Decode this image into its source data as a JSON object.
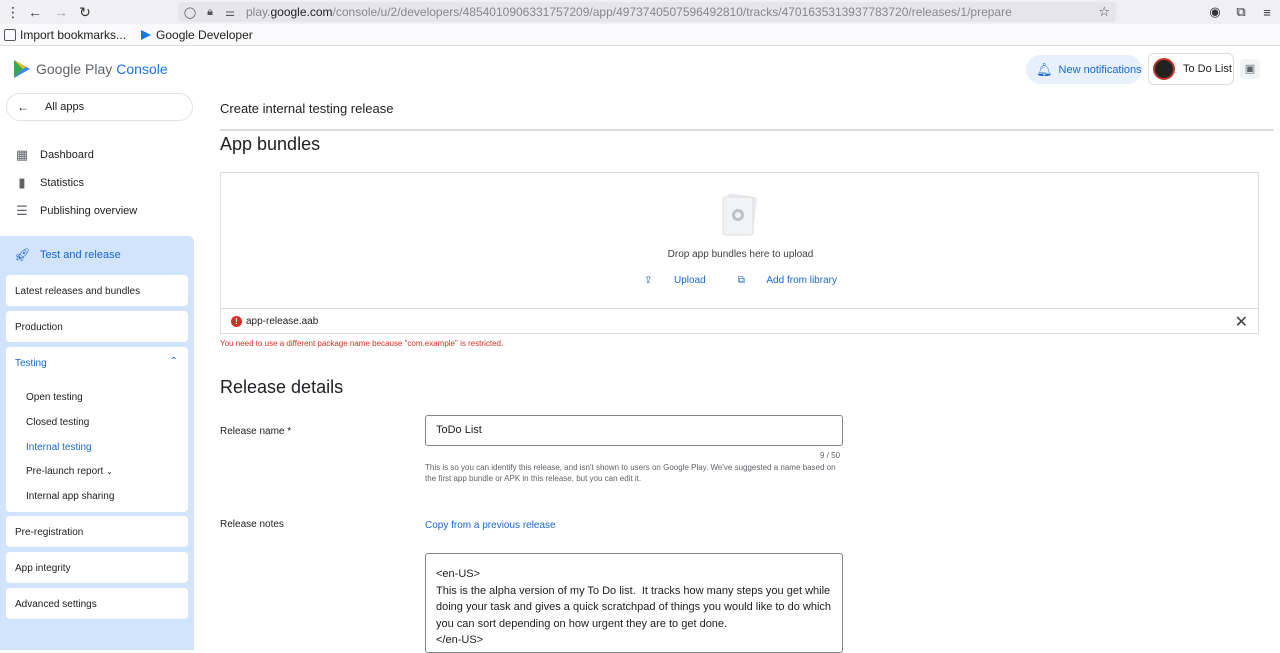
{
  "browser": {
    "url_prefix": "play.",
    "url_domain": "google.com",
    "url_path": "/console/u/2/developers/4854010906331757209/app/4973740507596492810/tracks/4701635313937783720/releases/1/prepare",
    "bookmarks": [
      {
        "label": "Import bookmarks..."
      },
      {
        "label": "Google Developer"
      }
    ]
  },
  "header": {
    "brand": "Google Play",
    "brand_suffix": "Console",
    "notifications_label": "New notifications",
    "account_label": "To Do List"
  },
  "sidebar": {
    "all_apps": "All apps",
    "items": [
      {
        "label": "Dashboard",
        "icon": "dashboard-icon"
      },
      {
        "label": "Statistics",
        "icon": "bar-chart-icon"
      },
      {
        "label": "Publishing overview",
        "icon": "publish-icon"
      }
    ],
    "section": {
      "label": "Test and release",
      "icon": "rocket-icon",
      "cards": [
        {
          "label": "Latest releases and bundles"
        },
        {
          "label": "Production"
        },
        {
          "label": "Testing"
        },
        {
          "label": "Pre-registration"
        },
        {
          "label": "App integrity"
        },
        {
          "label": "Advanced settings"
        }
      ],
      "testing_sub": [
        {
          "label": "Open testing"
        },
        {
          "label": "Closed testing"
        },
        {
          "label": "Internal testing"
        },
        {
          "label": "Pre-launch report"
        },
        {
          "label": "Internal app sharing"
        }
      ]
    }
  },
  "main": {
    "page_title": "Create internal testing release",
    "bundles_heading": "App bundles",
    "drop_text": "Drop app bundles here to upload",
    "upload_label": "Upload",
    "library_label": "Add from library",
    "file_name": "app-release.aab",
    "error_message": "You need to use a different package name because \"com.example\" is restricted.",
    "details_heading": "Release details",
    "release_name_label": "Release name  *",
    "release_name_value": "ToDo List",
    "release_name_counter": "9 / 50",
    "release_name_hint": "This is so you can identify this release, and isn't shown to users on Google Play. We've suggested a name based on the first app bundle or APK in this release, but you can edit it.",
    "release_notes_label": "Release notes",
    "copy_link": "Copy from a previous release",
    "release_notes_value": "<en-US>\nThis is the alpha version of my To Do list.  It tracks how many steps you get while doing your task and gives a quick scratchpad of things you would like to do which you can sort depending on how urgent they are to get done.\n</en-US>"
  }
}
